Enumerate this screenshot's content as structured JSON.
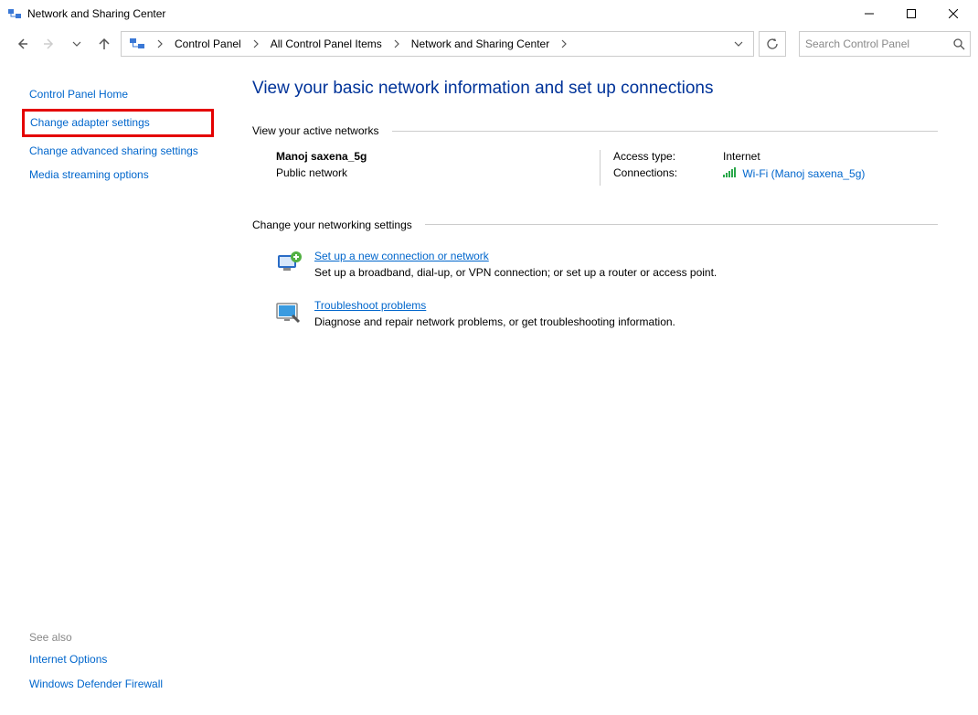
{
  "window": {
    "title": "Network and Sharing Center"
  },
  "breadcrumb": {
    "items": [
      "Control Panel",
      "All Control Panel Items",
      "Network and Sharing Center"
    ]
  },
  "search": {
    "placeholder": "Search Control Panel"
  },
  "sidebar": {
    "items": [
      {
        "label": "Control Panel Home"
      },
      {
        "label": "Change adapter settings"
      },
      {
        "label": "Change advanced sharing settings"
      },
      {
        "label": "Media streaming options"
      }
    ],
    "see_also_label": "See also",
    "see_also": [
      {
        "label": "Internet Options"
      },
      {
        "label": "Windows Defender Firewall"
      }
    ]
  },
  "main": {
    "title": "View your basic network information and set up connections",
    "active_networks_header": "View your active networks",
    "active_network": {
      "name": "Manoj saxena_5g",
      "type": "Public network",
      "access_label": "Access type:",
      "access_value": "Internet",
      "connections_label": "Connections:",
      "connection_link": "Wi-Fi (Manoj saxena_5g)"
    },
    "change_settings_header": "Change your networking settings",
    "settings": [
      {
        "title": "Set up a new connection or network",
        "desc": "Set up a broadband, dial-up, or VPN connection; or set up a router or access point."
      },
      {
        "title": "Troubleshoot problems",
        "desc": "Diagnose and repair network problems, or get troubleshooting information."
      }
    ]
  }
}
